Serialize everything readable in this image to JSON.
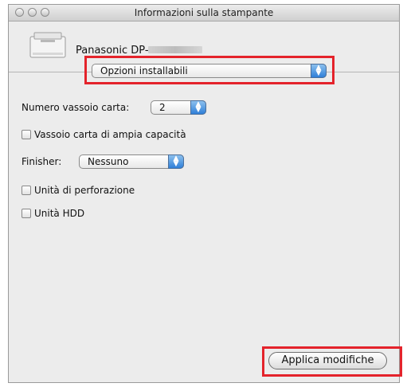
{
  "window": {
    "title": "Informazioni sulla stampante"
  },
  "printer": {
    "name": "Panasonic DP-"
  },
  "section_popup": {
    "selected": "Opzioni installabili"
  },
  "tray_count": {
    "label": "Numero vassoio carta:",
    "selected": "2"
  },
  "options": {
    "large_tray_label": "Vassoio carta di ampia capacità",
    "punch_label": "Unità di perforazione",
    "hdd_label": "Unità HDD"
  },
  "finisher": {
    "label": "Finisher:",
    "selected": "Nessuno"
  },
  "buttons": {
    "apply_label": "Applica modifiche"
  },
  "colors": {
    "highlight": "#e4232b",
    "popup_arrow": "#2f7fd8"
  }
}
